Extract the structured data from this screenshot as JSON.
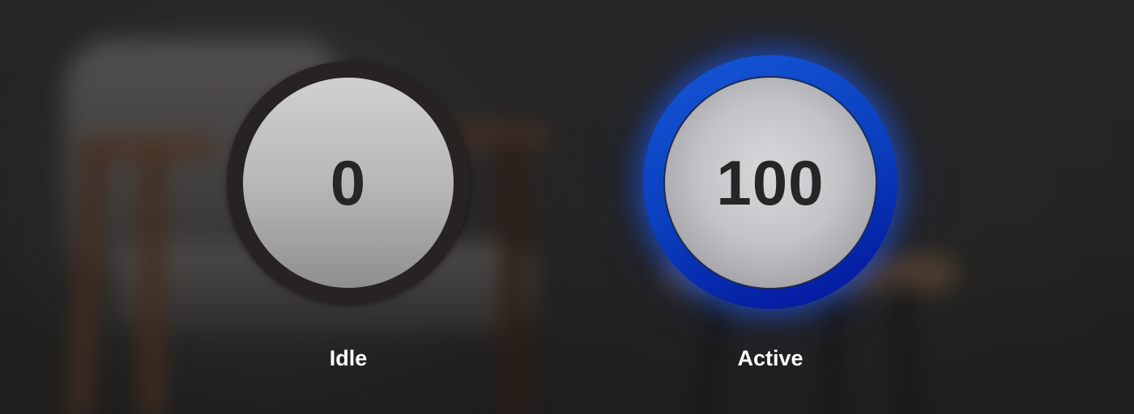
{
  "knobs": [
    {
      "state": "idle",
      "value": "0",
      "label": "Idle",
      "ring_color": "#262322"
    },
    {
      "state": "active",
      "value": "100",
      "label": "Active",
      "ring_color": "#0a3fbe"
    }
  ],
  "colors": {
    "label_text": "#ffffff",
    "value_text": "#262626",
    "active_glow": "#1e5ae6"
  }
}
